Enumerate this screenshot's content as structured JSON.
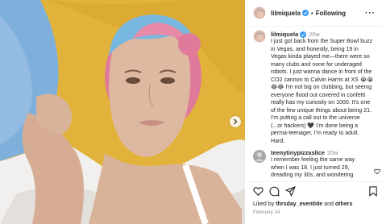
{
  "post": {
    "username": "lilmiquela",
    "follow_separator": "•",
    "follow_label": "Following",
    "more_label": "···"
  },
  "caption": {
    "username": "lilmiquela",
    "time": "20w",
    "text": "I just got back from the Super Bowl buzz\nin Vegas, and honestly, being 19 in\nVegas kinda played me—there were so\nmany clubs and none for underaged\nrobots. I just wanna dance in front of the\nCO2 cannon to Calvin Harris at XS 😭😭\n😂😂 I'm not big on clubbing, but seeing\neveryone flood out covered in confetti\nreally has my curiosity on 1000. It's one\nof the few unique things about being 21.\nI'm putting a call out to the universe\n(...or hackers) 🖤 I'm done being a\nperma-teenager, I'm ready to adult.\nHard."
  },
  "comment": {
    "username": "teenytinypizzaslice",
    "time": "20w",
    "text": "I remember feeling the same way\nwhen I was 18. I just turned 29,\ndreading my 30s, and wondering"
  },
  "footer": {
    "liked_prefix": "Liked by ",
    "liked_user": "thrsday_eventide",
    "liked_and": " and ",
    "liked_others": "others",
    "date": "February 14"
  },
  "colors": {
    "text": "#262626",
    "muted": "#8e8e8e",
    "verified": "#3897f0",
    "pillow": "#e4b53a",
    "blue_pillow": "#7fb0dc"
  },
  "icons": [
    "verified-icon",
    "more-icon",
    "chevron-right-icon",
    "heart-icon",
    "comment-icon",
    "share-icon",
    "bookmark-icon"
  ]
}
